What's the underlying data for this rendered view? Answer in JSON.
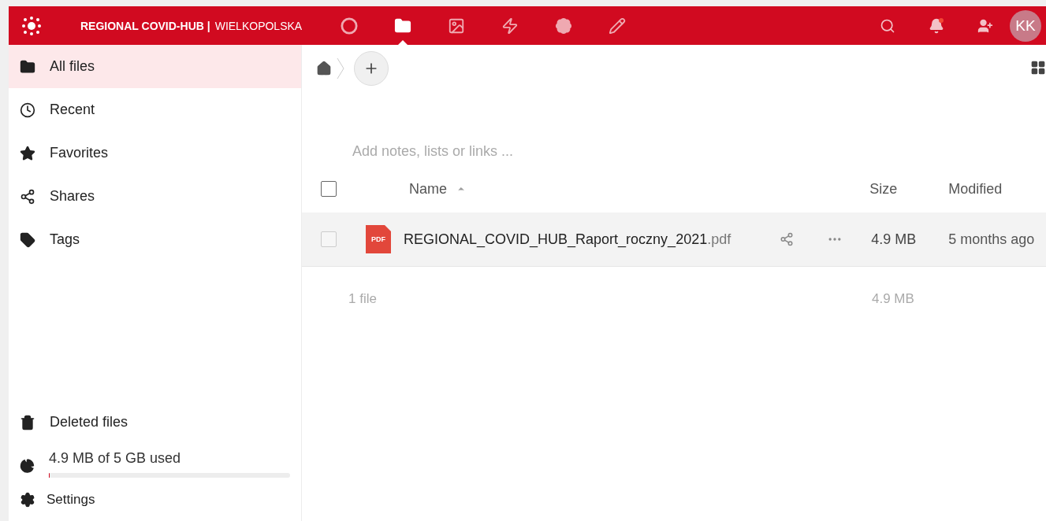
{
  "header": {
    "brand_bold": "REGIONAL COVID-HUB |",
    "brand_light": "WIELKOPOLSKA",
    "apps": [
      {
        "kind": "dashboard",
        "selected": false
      },
      {
        "kind": "files",
        "selected": true
      },
      {
        "kind": "photos",
        "selected": false
      },
      {
        "kind": "activity",
        "selected": false
      },
      {
        "kind": "apps",
        "selected": false
      },
      {
        "kind": "notes",
        "selected": false
      }
    ],
    "notification_unread": true,
    "avatar": "KK"
  },
  "sidebar": {
    "items": [
      {
        "kind": "folder",
        "label": "All files",
        "selected": true
      },
      {
        "kind": "recent",
        "label": "Recent",
        "selected": false
      },
      {
        "kind": "star",
        "label": "Favorites",
        "selected": false
      },
      {
        "kind": "share",
        "label": "Shares",
        "selected": false
      },
      {
        "kind": "tag",
        "label": "Tags",
        "selected": false
      }
    ],
    "deleted": "Deleted files",
    "quota": {
      "label": "4.9 MB of 5 GB used",
      "level": 0.001
    },
    "settings": "Settings"
  },
  "content": {
    "notes_placeholder": "Add notes, lists or links ...",
    "columns": {
      "name": "Name",
      "size": "Size",
      "modified": "Modified"
    },
    "select_all_checked": false,
    "files": [
      {
        "name": "REGIONAL_COVID_HUB_Raport_roczny_2021",
        "ext": ".pdf",
        "type_badge": "PDF",
        "size": "4.9 MB",
        "modified": "5 months ago",
        "checked": false
      }
    ],
    "summary": {
      "count": "1 file",
      "size": "4.9 MB"
    }
  }
}
